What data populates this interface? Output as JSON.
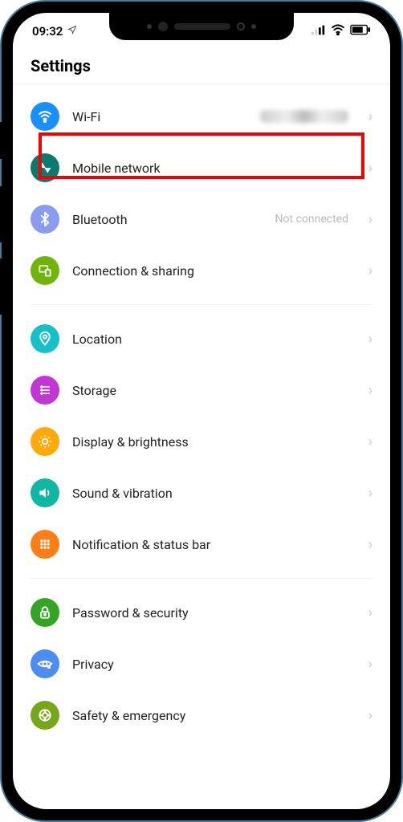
{
  "status": {
    "time": "09:32"
  },
  "header": {
    "title": "Settings"
  },
  "group1": [
    {
      "label": "Wi-Fi",
      "value": ""
    },
    {
      "label": "Mobile network",
      "value": ""
    },
    {
      "label": "Bluetooth",
      "value": "Not connected"
    },
    {
      "label": "Connection & sharing",
      "value": ""
    }
  ],
  "group2": [
    {
      "label": "Location"
    },
    {
      "label": "Storage"
    },
    {
      "label": "Display & brightness"
    },
    {
      "label": "Sound & vibration"
    },
    {
      "label": "Notification & status bar"
    }
  ],
  "group3": [
    {
      "label": "Password & security"
    },
    {
      "label": "Privacy"
    },
    {
      "label": "Safety & emergency"
    }
  ]
}
